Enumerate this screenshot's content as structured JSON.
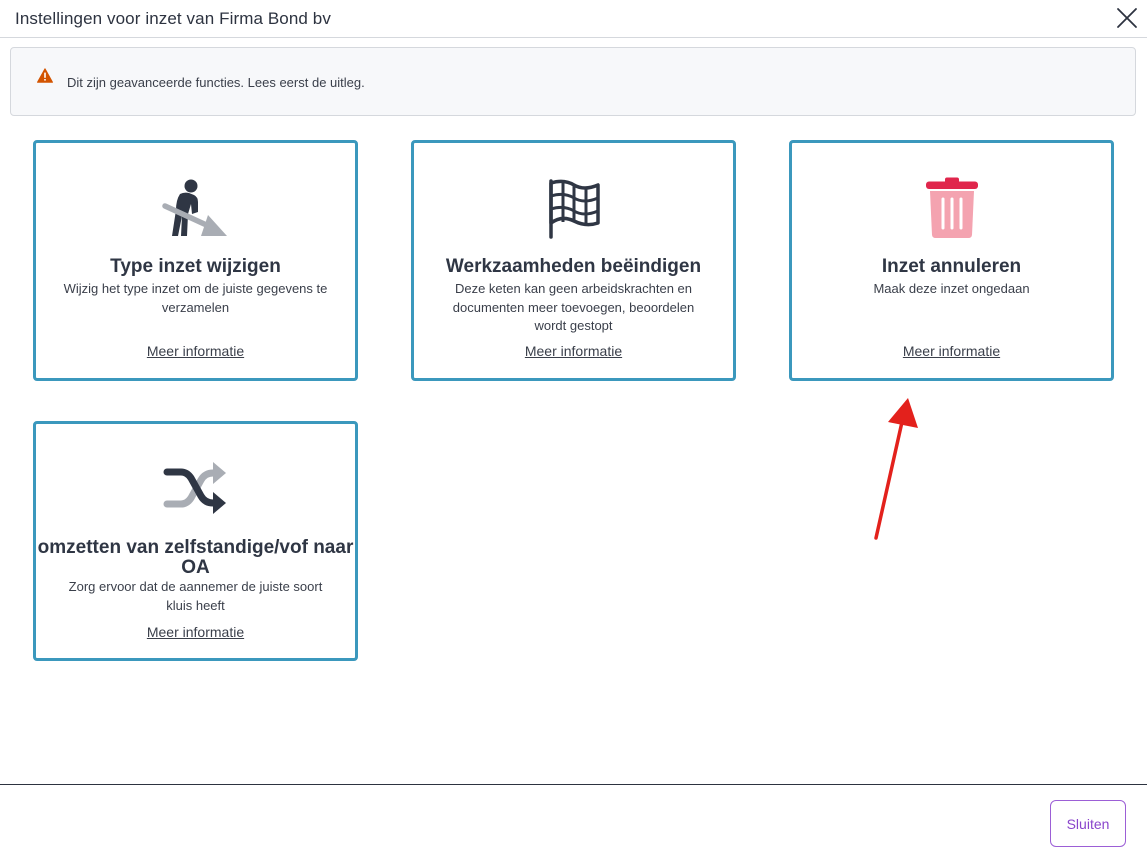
{
  "modal": {
    "title": "Instellingen voor inzet van Firma Bond bv"
  },
  "alert": {
    "text": "Dit zijn geavanceerde functies. Lees eerst de uitleg.",
    "icon": "warning-icon",
    "icon_color": "#d35400"
  },
  "cards": [
    {
      "icon": "worker-shovel-icon",
      "title": "Type inzet wijzigen",
      "description": "Wijzig het type inzet om de juiste gegevens te verzamelen",
      "link": "Meer informatie"
    },
    {
      "icon": "checkered-flag-icon",
      "title": "Werkzaamheden beëindigen",
      "description": "Deze keten kan geen arbeidskrachten en documenten meer toevoegen, beoordelen wordt gestopt",
      "link": "Meer informatie"
    },
    {
      "icon": "trash-icon",
      "title": "Inzet annuleren",
      "description": "Maak deze inzet ongedaan",
      "link": "Meer informatie"
    },
    {
      "icon": "shuffle-icon",
      "title": "omzetten van zelfstandige/vof naar OA",
      "description": "Zorg ervoor dat de aannemer de juiste soort kluis heeft",
      "link": "Meer informatie"
    }
  ],
  "footer": {
    "close_label": "Sluiten"
  },
  "colors": {
    "card_border": "#3b98bd",
    "close_button": "#8a45cc",
    "trash_lid": "#e0264c",
    "trash_body": "#f4a3b0",
    "annotation_arrow": "#e3211c"
  }
}
